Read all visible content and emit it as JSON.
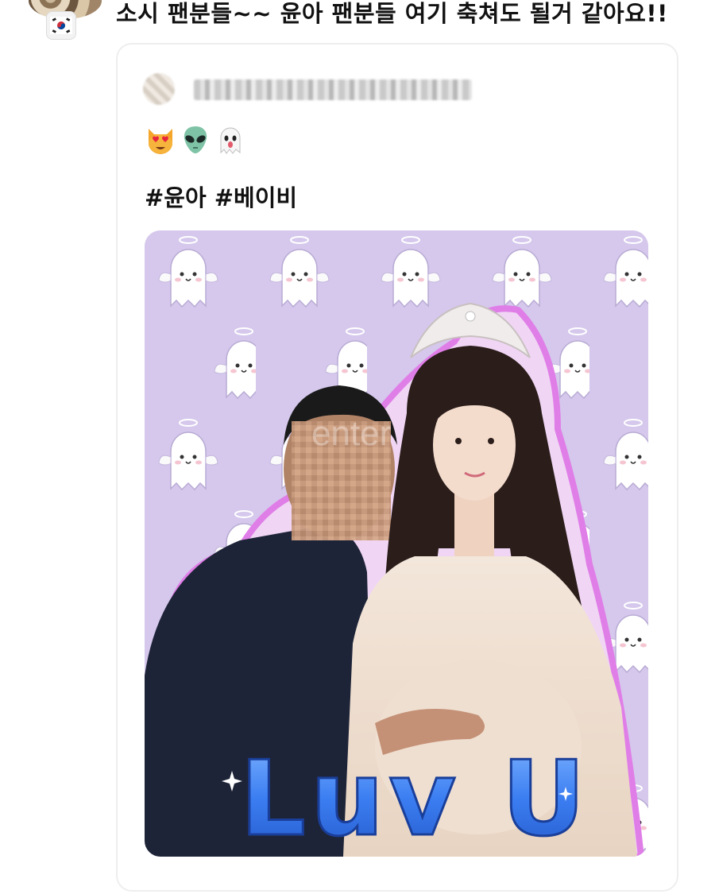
{
  "reply": {
    "text": "소시 팬분들~~ 윤아 팬분들 여기 축쳐도 될거 같아요!!",
    "avatar_icon": "user-avatar-icon",
    "flag_icon": "korea-flag-icon"
  },
  "quoted_post": {
    "username_blurred": true,
    "emojis": [
      "heart-eyes-cat-emoji",
      "alien-emoji",
      "ghost-emoji"
    ],
    "hashtags": "#윤아 #베이비",
    "image": {
      "overlay_text": "Luv U",
      "watermark": "enter",
      "background_color": "#d5c8ec",
      "accent_color": "#3b7ef2"
    }
  }
}
